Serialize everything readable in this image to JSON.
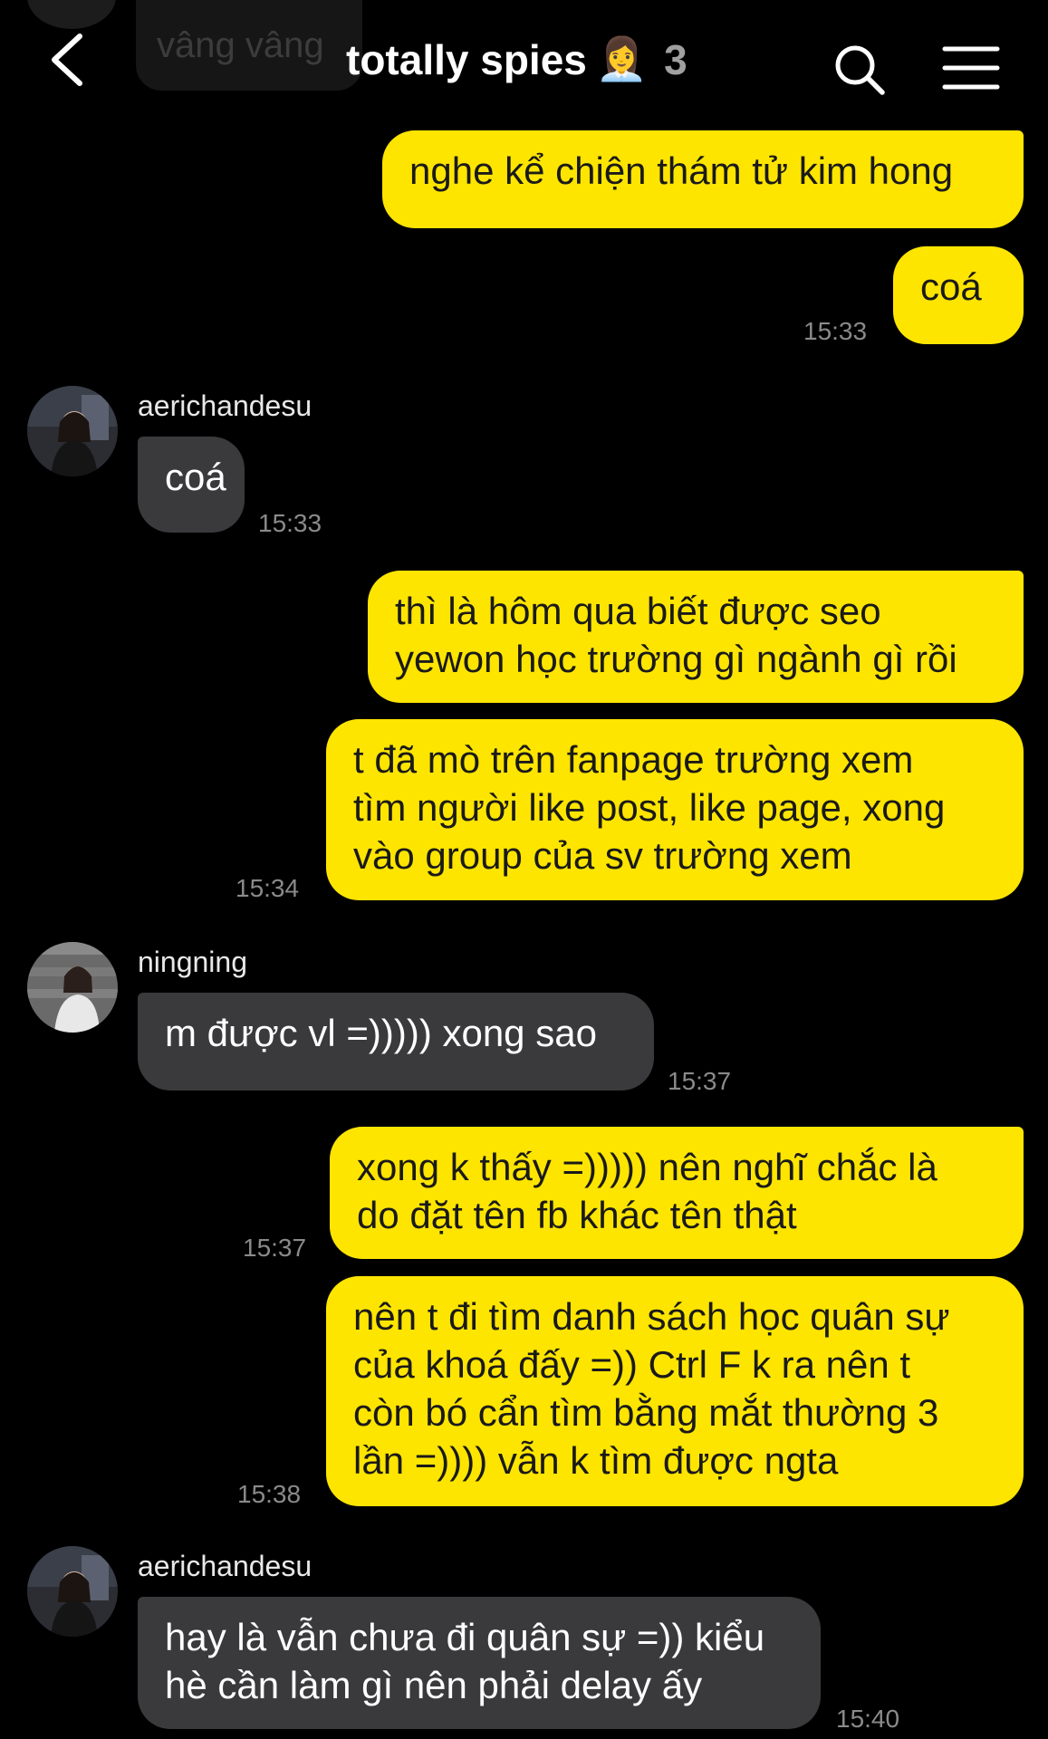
{
  "header": {
    "title": "totally spies",
    "emoji": "👩‍💼",
    "member_count": "3",
    "partial_message": "vâng vâng"
  },
  "messages": [
    {
      "side": "out",
      "lines": [
        "nghe kể chiện thám tử kim hong"
      ]
    },
    {
      "side": "out",
      "lines": [
        "coá"
      ],
      "time": "15:33"
    },
    {
      "side": "in",
      "sender": "aerichandesu",
      "lines": [
        "coá"
      ],
      "time": "15:33"
    },
    {
      "side": "out",
      "lines": [
        "thì là hôm qua biết được seo",
        "yewon học trường gì ngành gì rồi"
      ]
    },
    {
      "side": "out",
      "lines": [
        "t đã mò trên fanpage trường xem",
        "tìm người like post, like page, xong",
        "vào group của sv trường xem"
      ],
      "time": "15:34"
    },
    {
      "side": "in",
      "sender": "ningning",
      "lines": [
        "m được vl =))))) xong sao"
      ],
      "time": "15:37"
    },
    {
      "side": "out",
      "lines": [
        "xong k thấy =))))) nên nghĩ chắc là",
        "do đặt tên fb khác tên thật"
      ],
      "time": "15:37"
    },
    {
      "side": "out",
      "lines": [
        "nên t đi tìm danh sách học quân sự",
        "của khoá đấy =)) Ctrl F k ra nên t",
        "còn bó cẩn tìm bằng mắt thường 3",
        "lần =)))) vẫn k tìm được ngta"
      ],
      "time": "15:38"
    },
    {
      "side": "in",
      "sender": "aerichandesu",
      "lines": [
        "hay là vẫn chưa đi quân sự =)) kiểu",
        "hè cần làm gì nên phải delay ấy"
      ],
      "time": "15:40"
    }
  ],
  "colors": {
    "background": "#000000",
    "outgoing": "#fee500",
    "incoming": "#3a3a3c",
    "timestamp": "#8a8a8a"
  },
  "icons": [
    "back-chevron-icon",
    "search-icon",
    "menu-icon"
  ]
}
